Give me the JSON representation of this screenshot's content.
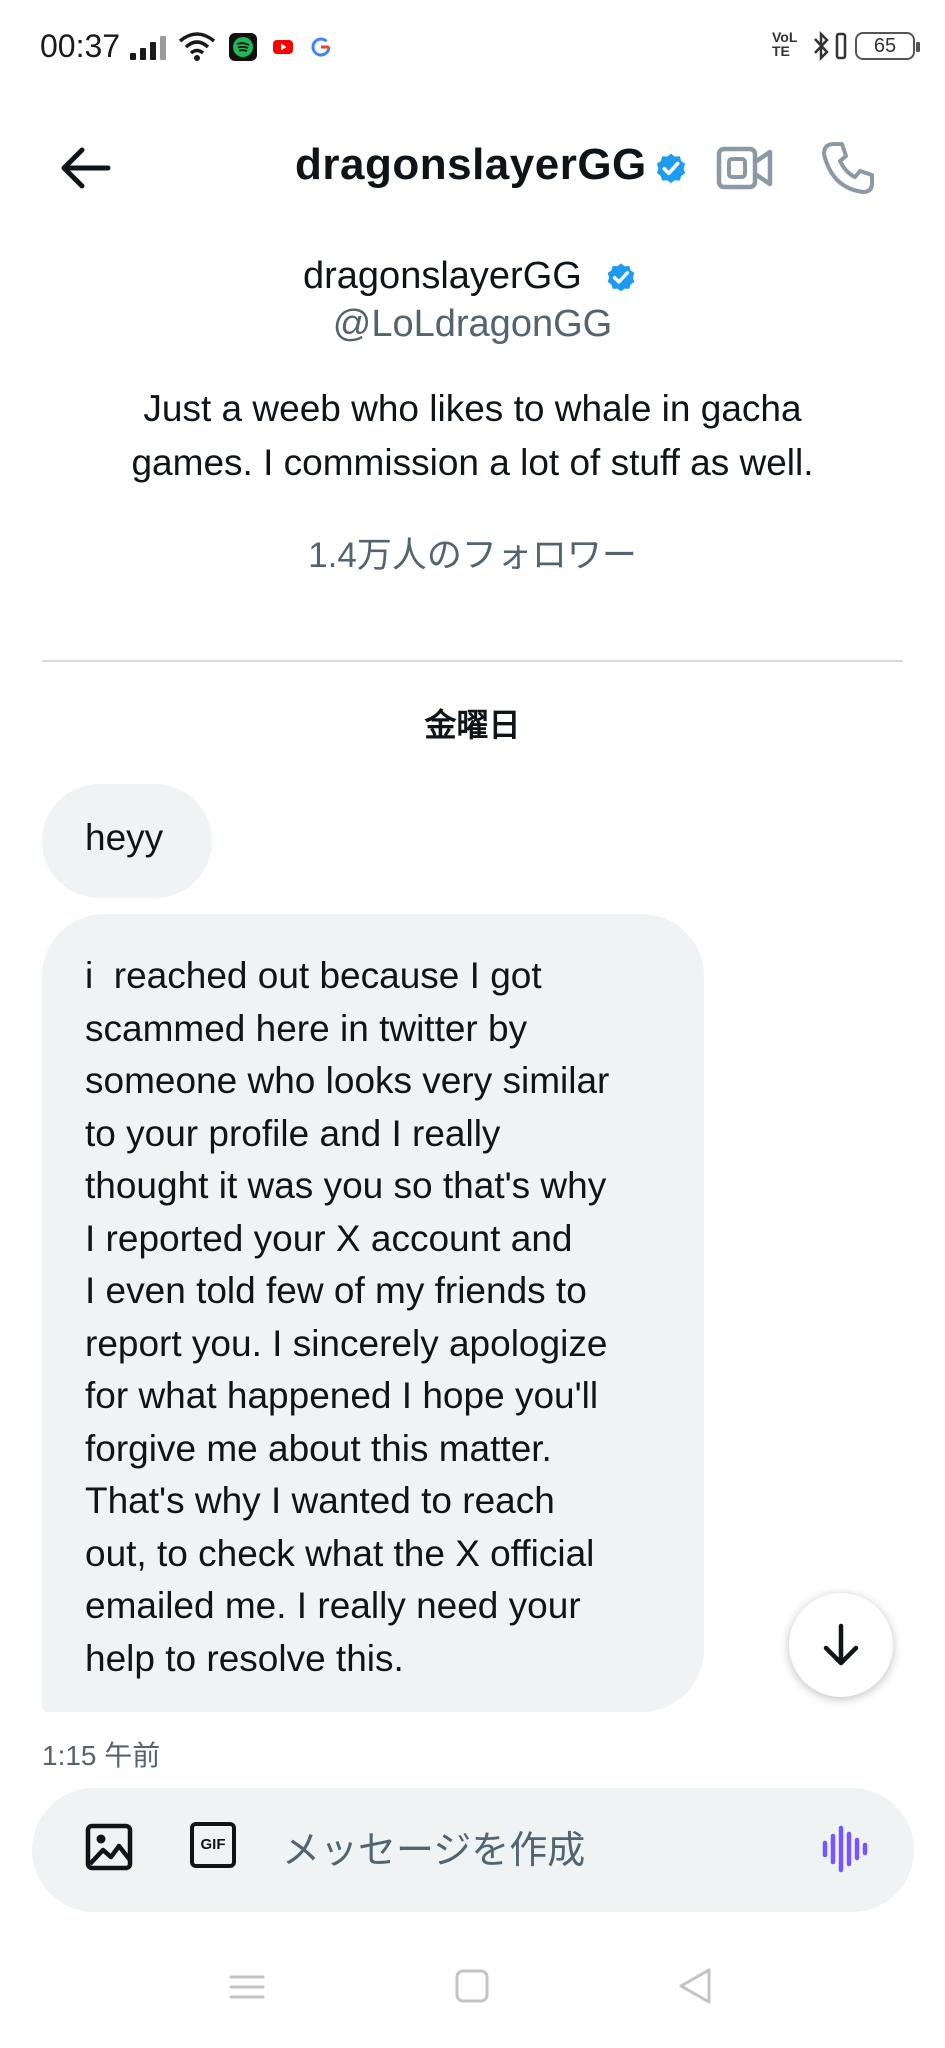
{
  "status_bar": {
    "time": "00:37",
    "battery": "65",
    "network": "VoLTE"
  },
  "header": {
    "title": "dragonslayerGG",
    "icons": [
      "back-arrow-icon",
      "verified-badge-icon",
      "video-call-icon",
      "phone-call-icon"
    ]
  },
  "profile": {
    "name": "dragonslayerGG",
    "handle": "@LoLdragonGG",
    "bio_line1": "Just a weeb who likes to whale in gacha",
    "bio_line2": "games. I commission a lot of stuff as well.",
    "followers": "1.4万人のフォロワー"
  },
  "conversation": {
    "day_label": "金曜日",
    "messages": [
      {
        "lines": [
          "heyy"
        ]
      },
      {
        "lines": [
          "i  reached out because I got",
          "scammed here in twitter by",
          "someone who looks very similar",
          "to your profile and I really",
          "thought it was you so that's why",
          "I reported your X account and",
          "I even told few of my friends to",
          "report you. I sincerely apologize",
          "for what happened I hope you'll",
          "forgive me about this matter.",
          "That's why I wanted to reach",
          "out, to check what the X official",
          "emailed me. I really need your",
          "help to resolve this."
        ]
      }
    ],
    "timestamp": "1:15 午前"
  },
  "composer": {
    "placeholder": "メッセージを作成",
    "gif_label": "GIF"
  },
  "colors": {
    "verified_blue": "#1d9bf0",
    "bubble_bg": "#eff3f4",
    "secondary_text": "#536471",
    "voice_purple": "#7856ff"
  }
}
